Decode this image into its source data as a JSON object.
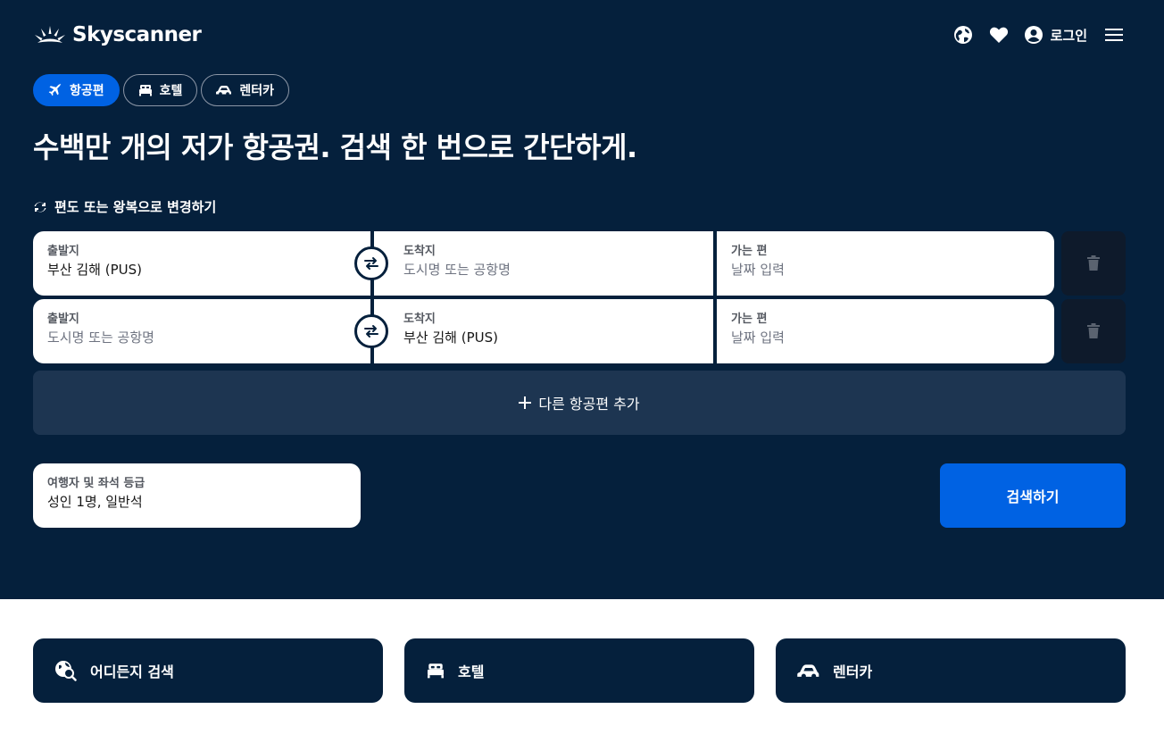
{
  "brand": {
    "name": "Skyscanner"
  },
  "header": {
    "login_label": "로그인"
  },
  "tabs": [
    {
      "label": "항공편",
      "icon": "plane-icon",
      "active": true
    },
    {
      "label": "호텔",
      "icon": "bed-icon",
      "active": false
    },
    {
      "label": "렌터카",
      "icon": "car-icon",
      "active": false
    }
  ],
  "headline": "수백만 개의 저가 항공권. 검색 한 번으로 간단하게.",
  "trip_toggle_label": "편도 또는 왕복으로 변경하기",
  "legs": [
    {
      "origin": {
        "label": "출발지",
        "value": "부산 김해 (PUS)"
      },
      "destination": {
        "label": "도착지",
        "placeholder": "도시명 또는 공항명"
      },
      "date": {
        "label": "가는 편",
        "placeholder": "날짜 입력"
      }
    },
    {
      "origin": {
        "label": "출발지",
        "placeholder": "도시명 또는 공항명"
      },
      "destination": {
        "label": "도착지",
        "value": "부산 김해 (PUS)"
      },
      "date": {
        "label": "가는 편",
        "placeholder": "날짜 입력"
      }
    }
  ],
  "add_leg_label": "다른 항공편 추가",
  "travellers": {
    "label": "여행자 및 좌석 등급",
    "value": "성인 1명, 일반석"
  },
  "search_label": "검색하기",
  "cards": [
    {
      "label": "어디든지 검색",
      "icon": "explore-icon"
    },
    {
      "label": "호텔",
      "icon": "bed-icon"
    },
    {
      "label": "렌터카",
      "icon": "car-icon"
    }
  ],
  "colors": {
    "hero_bg": "#05203c",
    "primary": "#0062e3",
    "add_leg_bg": "#1d3551",
    "delete_bg": "#0e1a2b"
  }
}
